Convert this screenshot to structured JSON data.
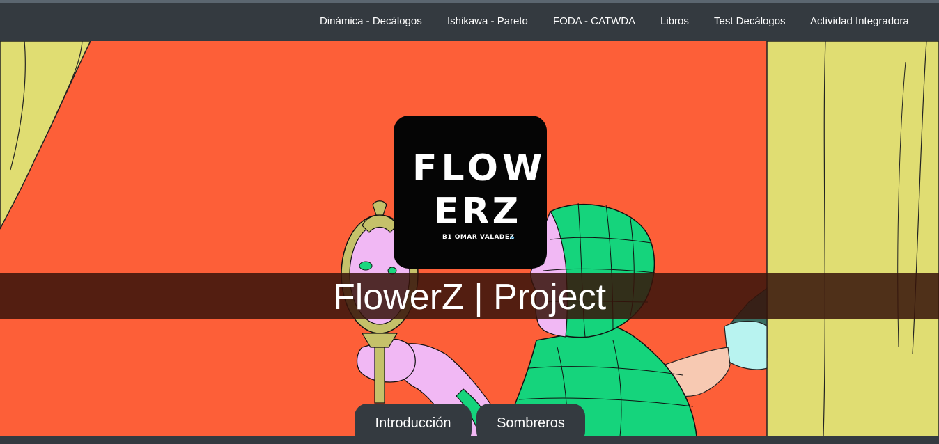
{
  "nav": {
    "items": [
      {
        "label": "Dinámica - Decálogos"
      },
      {
        "label": "Ishikawa - Pareto"
      },
      {
        "label": "FODA - CATWDA"
      },
      {
        "label": "Libros"
      },
      {
        "label": "Test Decálogos"
      },
      {
        "label": "Actividad Integradora"
      }
    ]
  },
  "logo": {
    "line1": "FLOW",
    "line2": "ERZ",
    "byline": "B1 OMAR VALADEZ",
    "arrow": "»"
  },
  "hero": {
    "title": "FlowerZ | Project"
  },
  "buttons": {
    "intro": "Introducción",
    "hats": "Sombreros"
  },
  "colors": {
    "navbar": "#343a40",
    "hero_background": "#fd5f38",
    "curtain": "#e0dd72",
    "mannequin": "#15d47c",
    "title_band": "#37140a"
  }
}
